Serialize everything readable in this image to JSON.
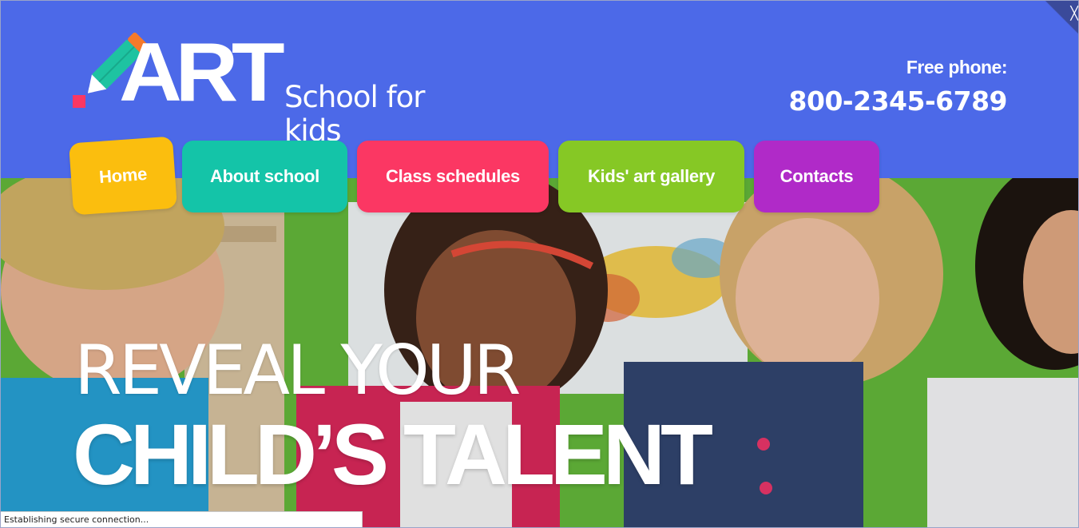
{
  "header": {
    "logo_text": "ART",
    "logo_subtitle": "School for kids",
    "phone_label": "Free phone:",
    "phone_number": "800-2345-6789",
    "background_color": "#4c69e8"
  },
  "nav": {
    "items": [
      {
        "label": "Home",
        "color": "#fbbe0e"
      },
      {
        "label": "About school",
        "color": "#14c4a8"
      },
      {
        "label": "Class schedules",
        "color": "#fb3763"
      },
      {
        "label": "Kids' art gallery",
        "color": "#86c825"
      },
      {
        "label": "Contacts",
        "color": "#b02ac8"
      }
    ]
  },
  "hero": {
    "line1": "REVEAL YOUR",
    "line2": "CHILD’S TALENT"
  },
  "status": {
    "text": "Establishing secure connection..."
  },
  "icons": {
    "logo": "pencil-icon",
    "corner": "close-icon"
  }
}
